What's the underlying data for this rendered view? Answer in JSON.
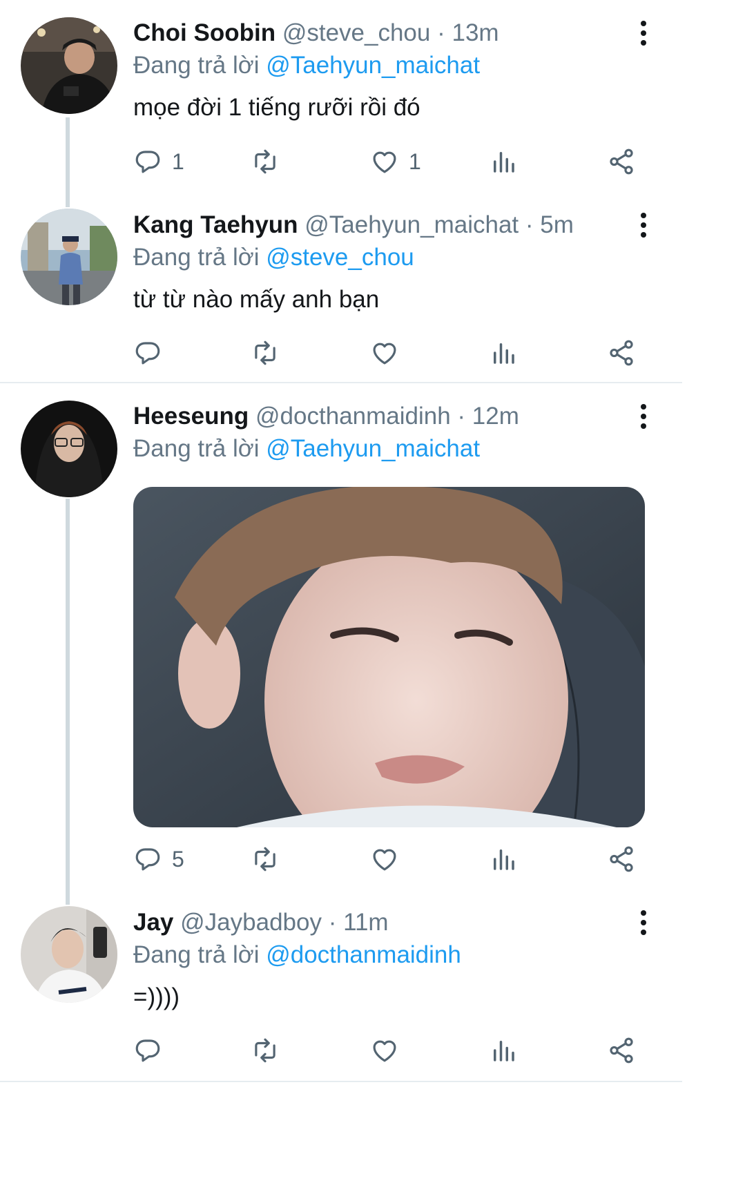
{
  "tweets": [
    {
      "name": "Choi Soobin",
      "handle": "@steve_chou",
      "dot": "·",
      "time": "13m",
      "reply_prefix": "Đang trả lời",
      "reply_to": "@Taehyun_maichat",
      "text": "mọe đời 1 tiếng rưỡi rồi đó",
      "reply_count": "1",
      "like_count": "1"
    },
    {
      "name": "Kang Taehyun",
      "handle": "@Taehyun_maichat",
      "dot": "·",
      "time": "5m",
      "reply_prefix": "Đang trả lời",
      "reply_to": "@steve_chou",
      "text": "từ từ nào mấy anh bạn",
      "reply_count": "",
      "like_count": ""
    },
    {
      "name": "Heeseung",
      "handle": "@docthanmaidinh",
      "dot": "·",
      "time": "12m",
      "reply_prefix": "Đang trả lời",
      "reply_to": "@Taehyun_maichat",
      "text": "",
      "reply_count": "5",
      "like_count": ""
    },
    {
      "name": "Jay",
      "handle": "@Jaybadboy",
      "dot": "·",
      "time": "11m",
      "reply_prefix": "Đang trả lời",
      "reply_to": "@docthanmaidinh",
      "text": "=))))",
      "reply_count": "",
      "like_count": ""
    }
  ],
  "icons": [
    "reply-icon",
    "retweet-icon",
    "like-icon",
    "analytics-icon",
    "share-icon",
    "more-icon"
  ],
  "colors": {
    "mention": "#1d9bf0",
    "secondary_text": "#657786",
    "thread_line": "#cfd9de"
  }
}
